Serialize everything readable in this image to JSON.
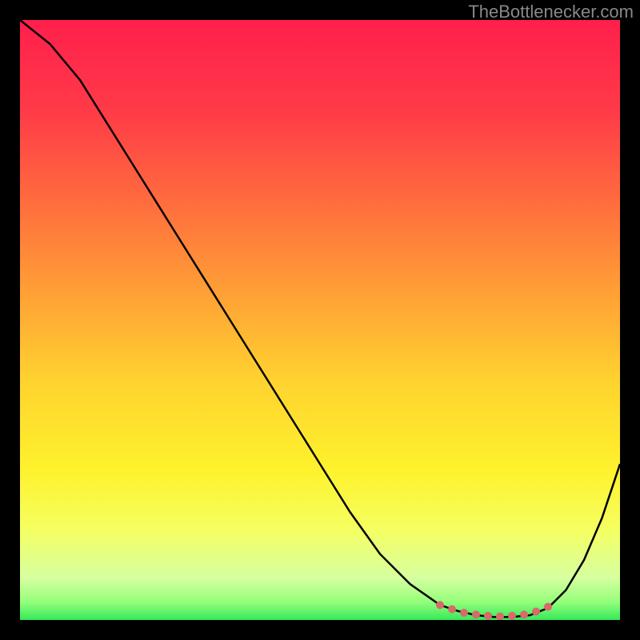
{
  "watermark": "TheBottlenecker.com",
  "chart_data": {
    "type": "line",
    "title": "",
    "xlabel": "",
    "ylabel": "",
    "xlim": [
      0,
      100
    ],
    "ylim": [
      0,
      100
    ],
    "series": [
      {
        "name": "curve",
        "x": [
          0,
          5,
          10,
          15,
          20,
          25,
          30,
          35,
          40,
          45,
          50,
          55,
          60,
          65,
          70,
          73,
          76,
          79,
          82,
          85,
          88,
          91,
          94,
          97,
          100
        ],
        "values": [
          100,
          96,
          90,
          82,
          74,
          66,
          58,
          50,
          42,
          34,
          26,
          18,
          11,
          6,
          2.5,
          1.5,
          0.8,
          0.5,
          0.5,
          0.8,
          2,
          5,
          10,
          17,
          26
        ]
      }
    ],
    "markers": {
      "x": [
        70,
        72,
        74,
        76,
        78,
        80,
        82,
        84,
        86,
        88
      ],
      "values": [
        2.5,
        1.8,
        1.2,
        0.9,
        0.7,
        0.6,
        0.7,
        0.9,
        1.4,
        2.2
      ],
      "color": "#d86a6a"
    },
    "gradient_stops": [
      {
        "pos": 0.0,
        "color": "#ff1f4c"
      },
      {
        "pos": 0.15,
        "color": "#ff3a47"
      },
      {
        "pos": 0.3,
        "color": "#ff6b3e"
      },
      {
        "pos": 0.45,
        "color": "#ff9e36"
      },
      {
        "pos": 0.6,
        "color": "#ffd22f"
      },
      {
        "pos": 0.75,
        "color": "#fef22c"
      },
      {
        "pos": 0.85,
        "color": "#f5ff62"
      },
      {
        "pos": 0.93,
        "color": "#d6ffa0"
      },
      {
        "pos": 0.97,
        "color": "#94ff7a"
      },
      {
        "pos": 1.0,
        "color": "#35e85a"
      }
    ]
  }
}
